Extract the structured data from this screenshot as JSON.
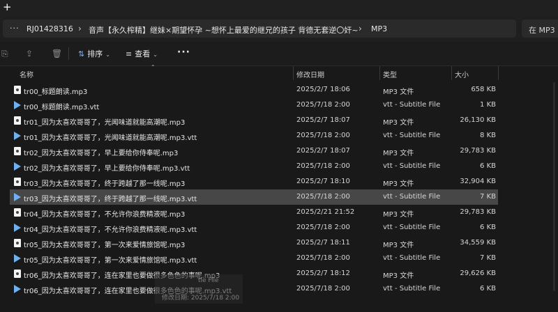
{
  "titlebar": {
    "new_tab_icon": "+"
  },
  "address": {
    "more_icon": "···",
    "crumbs": [
      "RJ01428316",
      "音声【永久榨精】继妹×期望怀孕 ~想怀上最爱的继兄的孩子 背德无套逆〇奸~",
      "MP3"
    ],
    "separator": "›",
    "search_placeholder": "在 MP3 中"
  },
  "toolbar": {
    "sort_label": "排序",
    "view_label": "查看",
    "more_label": "···"
  },
  "columns": {
    "name": "名称",
    "date": "修改日期",
    "type": "类型",
    "size": "大小"
  },
  "files": [
    {
      "name": "tr00_标题朗读.mp3",
      "date": "2025/2/7 18:06",
      "type": "MP3 文件",
      "size": "658 KB",
      "kind": "mp3"
    },
    {
      "name": "tr00_标题朗读.mp3.vtt",
      "date": "2025/7/18 2:00",
      "type": "vtt - Subtitle File",
      "size": "1 KB",
      "kind": "vtt"
    },
    {
      "name": "tr01_因为太喜欢哥哥了，光闻味道就能高潮呢.mp3",
      "date": "2025/2/7 18:07",
      "type": "MP3 文件",
      "size": "26,130 KB",
      "kind": "mp3"
    },
    {
      "name": "tr01_因为太喜欢哥哥了，光闻味道就能高潮呢.mp3.vtt",
      "date": "2025/7/18 2:00",
      "type": "vtt - Subtitle File",
      "size": "8 KB",
      "kind": "vtt"
    },
    {
      "name": "tr02_因为太喜欢哥哥了，早上要给你侍奉呢.mp3",
      "date": "2025/2/7 18:07",
      "type": "MP3 文件",
      "size": "29,783 KB",
      "kind": "mp3"
    },
    {
      "name": "tr02_因为太喜欢哥哥了，早上要给你侍奉呢.mp3.vtt",
      "date": "2025/7/18 2:00",
      "type": "vtt - Subtitle File",
      "size": "6 KB",
      "kind": "vtt"
    },
    {
      "name": "tr03_因为太喜欢哥哥了，终于跨越了那一线呢.mp3",
      "date": "2025/2/7 18:10",
      "type": "MP3 文件",
      "size": "32,904 KB",
      "kind": "mp3"
    },
    {
      "name": "tr03_因为太喜欢哥哥了，终于跨越了那一线呢.mp3.vtt",
      "date": "2025/7/18 2:00",
      "type": "vtt - Subtitle File",
      "size": "7 KB",
      "kind": "vtt",
      "selected": true
    },
    {
      "name": "tr04_因为太喜欢哥哥了，不允许你浪费精液呢.mp3",
      "date": "2025/2/21 21:52",
      "type": "MP3 文件",
      "size": "29,783 KB",
      "kind": "mp3"
    },
    {
      "name": "tr04_因为太喜欢哥哥了，不允许你浪费精液呢.mp3.vtt",
      "date": "2025/7/18 2:00",
      "type": "vtt - Subtitle File",
      "size": "6 KB",
      "kind": "vtt"
    },
    {
      "name": "tr05_因为太喜欢哥哥了，第一次来爱情旅馆呢.mp3",
      "date": "2025/2/7 18:11",
      "type": "MP3 文件",
      "size": "34,559 KB",
      "kind": "mp3"
    },
    {
      "name": "tr05_因为太喜欢哥哥了，第一次来爱情旅馆呢.mp3.vtt",
      "date": "2025/7/18 2:00",
      "type": "vtt - Subtitle File",
      "size": "7 KB",
      "kind": "vtt"
    },
    {
      "name": "tr06_因为太喜欢哥哥了，连在家里也要做很多色色的事呢.mp3",
      "date": "2025/2/7 18:12",
      "type": "MP3 文件",
      "size": "29,626 KB",
      "kind": "mp3"
    },
    {
      "name": "tr06_因为太喜欢哥哥了，连在家里也要做很多色色的事呢.mp3.vtt",
      "date": "2025/7/18 2:00",
      "type": "vtt - Subtitle File",
      "size": "6 KB",
      "kind": "vtt"
    }
  ],
  "tooltip": {
    "line1": "tle File",
    "line2": "修改日期: 2025/7/18 2:00"
  }
}
